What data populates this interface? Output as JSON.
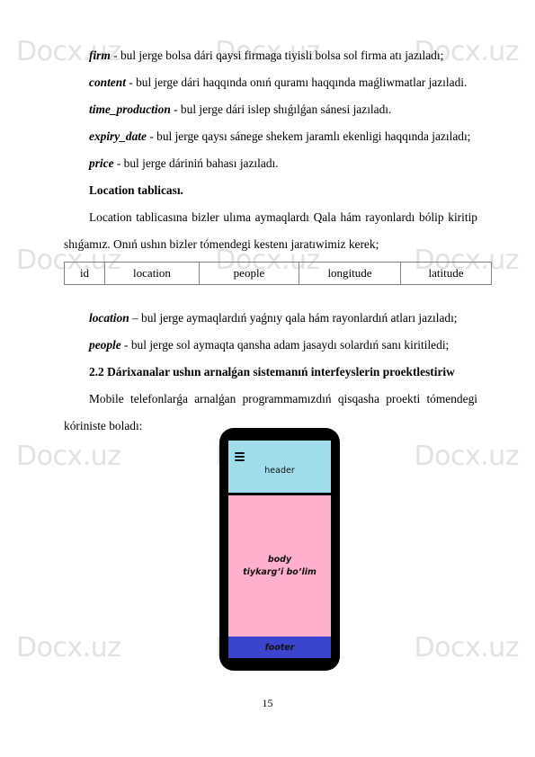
{
  "watermark": {
    "text": "Docx.uz",
    "columns": 3,
    "rows": 4,
    "color": "#e2e2e2"
  },
  "document": {
    "paragraphs": [
      {
        "id": "firm",
        "term": "firm",
        "text": " - bul jerge bolsa dári qaysi firmaga tiyisli bolsa sol firma atı jazıladı;"
      },
      {
        "id": "content",
        "term": "content",
        "text": " - bul jerge dári haqqında onıń quramı haqqında maǵliwmatlar jazıladi."
      },
      {
        "id": "time-production",
        "term": "time_production",
        "text": " - bul jerge dári islep shıǵılǵan sánesi jazıladı."
      },
      {
        "id": "expiry-date",
        "term": "expiry_date",
        "text": " - bul jerge qaysı sánege shekem jaramlı ekenligi haqqında jazıladı;"
      },
      {
        "id": "price",
        "term": "price",
        "text": " - bul jerge dáriniń bahası jazıladı."
      }
    ],
    "location_heading": "Location tablicası.",
    "location_intro": "Location tablicasına bizler ulıma aymaqlardı Qala hám rayonlardı bólip kiritip shıǵamız. Onıń ushın bizler tómendegi kestenı jaratıwimiz kerek;",
    "table": {
      "headers": [
        "id",
        "location",
        "people",
        "longitude",
        "latitude"
      ]
    },
    "paragraphs_after_table": [
      {
        "id": "location",
        "term": "location",
        "text": " – bul jerge aymaqlardıń yaǵnıy qala hám rayonlardıń atları jazıladı;"
      },
      {
        "id": "people",
        "term": "people",
        "text": " - bul jerge sol aymaqta qansha adam jasaydı solardıń sanı kiritiledi;"
      }
    ],
    "section_heading": "2.2 Dárixanalar ushın arnalǵan sistemanıń interfeyslerin proektlestiriw",
    "closing_paragraph": "Mobile telefonlarǵa arnalǵan programmamızdıń qisqasha proekti tómendegi kóriniste boladı:",
    "page_number": "15"
  },
  "phone_mockup": {
    "header": {
      "label": "header",
      "color": "#A0DCEC",
      "menu_icon": "hamburger-icon"
    },
    "body": {
      "line1": "body",
      "line2": "tiykarg’i bo’lim",
      "color": "#FFAFCC"
    },
    "footer": {
      "label": "footer",
      "color": "#3A44CC"
    },
    "frame_color": "#000000"
  }
}
